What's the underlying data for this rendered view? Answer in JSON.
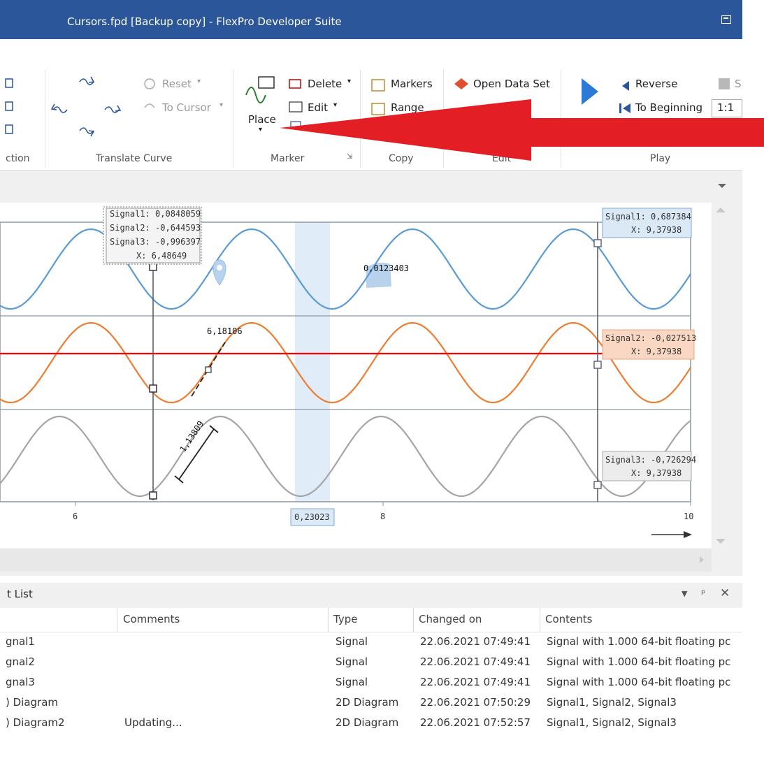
{
  "window": {
    "title": "Cursors.fpd [Backup copy] - FlexPro Developer Suite"
  },
  "ribbon": {
    "groups": {
      "selection": "ction",
      "translate_curve": "Translate Curve",
      "marker": "Marker",
      "copy": "Copy",
      "edit": "Edit",
      "play": "Play"
    },
    "buttons": {
      "reset": "Reset",
      "to_cursor": "To Cursor",
      "place": "Place",
      "delete": "Delete",
      "edit": "Edit",
      "markers": "Markers",
      "range": "Range",
      "open_data_set": "Open Data Set",
      "reverse": "Reverse",
      "to_beginning": "To Beginning",
      "ratio": "1:1",
      "truncated_s": "S"
    }
  },
  "diagram": {
    "cursor1": {
      "signal1": "Signal1: 0,0848059",
      "signal2": "Signal2: -0,644593",
      "signal3": "Signal3: -0,996397",
      "x": "X: 6,48649"
    },
    "cursor2": {
      "signal1": "Signal1: 0,687384",
      "signal1_x": "X: 9,37938",
      "signal2": "Signal2: -0,027513",
      "signal2_x": "X: 9,37938",
      "signal3": "Signal3: -0,726294",
      "signal3_x": "X: 9,37938"
    },
    "annotations": {
      "area_value": "0,0123403",
      "slope_value": "6,18106",
      "distance_value": "1,13809",
      "range_width": "0,23023"
    },
    "x_ticks": [
      "6",
      "8",
      "10"
    ],
    "colors": {
      "signal1": "#5b9bd5",
      "signal2": "#ed7d31",
      "signal3": "#a5a5a5",
      "level_line": "#ff0000"
    }
  },
  "object_list": {
    "title": "t List",
    "columns": {
      "name": "",
      "comments": "Comments",
      "type": "Type",
      "changed_on": "Changed on",
      "contents": "Contents"
    },
    "rows": [
      {
        "name": "gnal1",
        "comments": "",
        "type": "Signal",
        "changed_on": "22.06.2021 07:49:41",
        "contents": "Signal with 1.000 64-bit floating pc"
      },
      {
        "name": "gnal2",
        "comments": "",
        "type": "Signal",
        "changed_on": "22.06.2021 07:49:41",
        "contents": "Signal with 1.000 64-bit floating pc"
      },
      {
        "name": "gnal3",
        "comments": "",
        "type": "Signal",
        "changed_on": "22.06.2021 07:49:41",
        "contents": "Signal with 1.000 64-bit floating pc"
      },
      {
        "name": ") Diagram",
        "comments": "",
        "type": "2D Diagram",
        "changed_on": "22.06.2021 07:50:29",
        "contents": "Signal1, Signal2, Signal3"
      },
      {
        "name": ") Diagram2",
        "comments": "Updating...",
        "type": "2D Diagram",
        "changed_on": "22.06.2021 07:52:57",
        "contents": "Signal1, Signal2, Signal3"
      }
    ]
  }
}
